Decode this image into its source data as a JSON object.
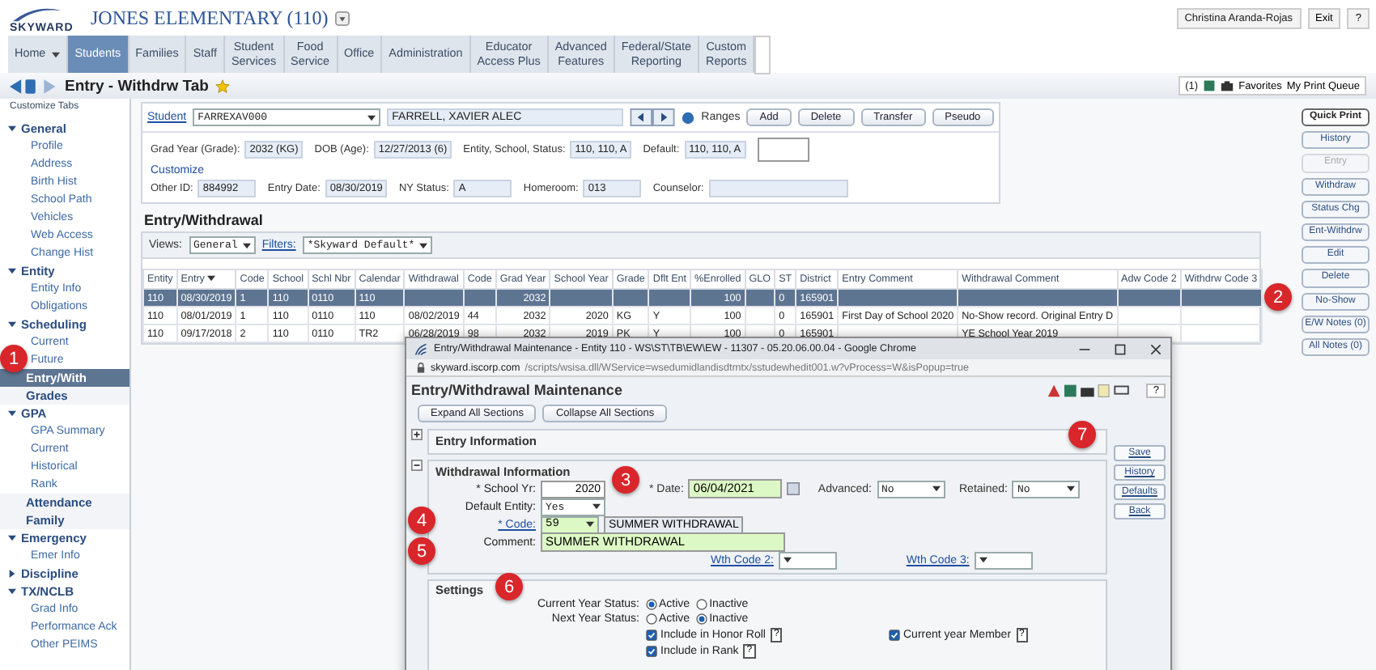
{
  "header": {
    "logo": "SKYWARD",
    "school": "JONES ELEMENTARY (110)",
    "user": "Christina Aranda-Rojas",
    "links": [
      "Exit",
      "?"
    ]
  },
  "nav": [
    {
      "label": "Home",
      "selected": false,
      "dropdown": true
    },
    {
      "label": "Students",
      "selected": true,
      "dropdown": false
    },
    {
      "label": "Families",
      "selected": false,
      "dropdown": false
    },
    {
      "label": "Staff",
      "selected": false,
      "dropdown": false
    },
    {
      "label": "Student\nServices",
      "selected": false,
      "dropdown": false
    },
    {
      "label": "Food\nService",
      "selected": false,
      "dropdown": false
    },
    {
      "label": "Office",
      "selected": false,
      "dropdown": false
    },
    {
      "label": "Administration",
      "selected": false,
      "dropdown": false
    },
    {
      "label": "Educator\nAccess Plus",
      "selected": false,
      "dropdown": false
    },
    {
      "label": "Advanced\nFeatures",
      "selected": false,
      "dropdown": false
    },
    {
      "label": "Federal/State\nReporting",
      "selected": false,
      "dropdown": false
    },
    {
      "label": "Custom\nReports",
      "selected": false,
      "dropdown": false
    }
  ],
  "crumb": {
    "title": "Entry - Withdrw Tab",
    "count": "(1)",
    "favorites": "Favorites",
    "print_queue": "My Print Queue"
  },
  "sidebar": {
    "header": "Customize Tabs",
    "items": [
      {
        "kind": "folder",
        "label": "General",
        "expanded": true,
        "children": [
          {
            "label": "Profile",
            "selected": false
          },
          {
            "label": "Address",
            "selected": false
          },
          {
            "label": "Birth Hist",
            "selected": false
          },
          {
            "label": "School Path",
            "selected": false
          },
          {
            "label": "Vehicles",
            "selected": false
          },
          {
            "label": "Web Access",
            "selected": false
          },
          {
            "label": "Change Hist",
            "selected": false
          }
        ]
      },
      {
        "kind": "folder",
        "label": "Entity",
        "expanded": true,
        "children": [
          {
            "label": "Entity Info",
            "selected": false
          },
          {
            "label": "Obligations",
            "selected": false
          }
        ]
      },
      {
        "kind": "folder",
        "label": "Scheduling",
        "expanded": true,
        "children": [
          {
            "label": "Current",
            "selected": false
          },
          {
            "label": "Future",
            "selected": false
          }
        ]
      },
      {
        "kind": "tab",
        "label": "Entry/With",
        "selected": true
      },
      {
        "kind": "tab",
        "label": "Grades",
        "selected": false
      },
      {
        "kind": "folder",
        "label": "GPA",
        "expanded": true,
        "children": [
          {
            "label": "GPA Summary",
            "selected": false
          },
          {
            "label": "Current",
            "selected": false
          },
          {
            "label": "Historical",
            "selected": false
          },
          {
            "label": "Rank",
            "selected": false
          }
        ]
      },
      {
        "kind": "tab",
        "label": "Attendance",
        "selected": false
      },
      {
        "kind": "tab",
        "label": "Family",
        "selected": false
      },
      {
        "kind": "folder",
        "label": "Emergency",
        "expanded": true,
        "children": [
          {
            "label": "Emer Info",
            "selected": false
          }
        ]
      },
      {
        "kind": "folder",
        "label": "Discipline",
        "expanded": false
      },
      {
        "kind": "folder",
        "label": "TX/NCLB",
        "expanded": true,
        "children": [
          {
            "label": "Grad Info",
            "selected": false
          },
          {
            "label": "Performance Ack",
            "selected": false
          },
          {
            "label": "Other PEIMS",
            "selected": false
          }
        ]
      }
    ]
  },
  "student": {
    "link": "Student",
    "id": "FARREXAV000",
    "name": "FARRELL, XAVIER ALEC",
    "ranges": "Ranges",
    "buttons": [
      "Add",
      "Delete",
      "Transfer",
      "Pseudo"
    ],
    "fields_top": [
      {
        "label": "Grad Year (Grade):",
        "value": "2032 (KG)"
      },
      {
        "label": "DOB (Age):",
        "value": "12/27/2013 (6)"
      },
      {
        "label": "Entity, School, Status:",
        "value": "110, 110, A"
      },
      {
        "label": "Default:",
        "value": "110, 110, A"
      }
    ],
    "customize": "Customize",
    "fields_bottom": [
      {
        "label": "Other ID:",
        "value": "884992"
      },
      {
        "label": "Entry Date:",
        "value": "08/30/2019"
      },
      {
        "label": "NY Status:",
        "value": "A"
      },
      {
        "label": "Homeroom:",
        "value": "013"
      },
      {
        "label": "Counselor:"
      }
    ]
  },
  "section": {
    "title": "Entry/Withdrawal",
    "views_label": "Views:",
    "view": "General",
    "filters_label": "Filters:",
    "filter": "*Skyward Default*"
  },
  "table": {
    "columns": [
      {
        "label": "Entity",
        "sorted": false
      },
      {
        "label": "Entry",
        "sorted": true
      },
      {
        "label": "Code",
        "sorted": false
      },
      {
        "label": "School",
        "sorted": false
      },
      {
        "label": "Schl Nbr",
        "sorted": false
      },
      {
        "label": "Calendar",
        "sorted": false
      },
      {
        "label": "Withdrawal",
        "sorted": false
      },
      {
        "label": "Code",
        "sorted": false
      },
      {
        "label": "Grad Year",
        "sorted": false
      },
      {
        "label": "School Year",
        "sorted": false
      },
      {
        "label": "Grade",
        "sorted": false
      },
      {
        "label": "Dflt Ent",
        "sorted": false
      },
      {
        "label": "%Enrolled",
        "sorted": false
      },
      {
        "label": "GLO",
        "sorted": false
      },
      {
        "label": "ST",
        "sorted": false
      },
      {
        "label": "District",
        "sorted": false
      },
      {
        "label": "Entry Comment",
        "sorted": false
      },
      {
        "label": "Withdrawal Comment",
        "sorted": false
      },
      {
        "label": "Adw Code 2",
        "sorted": false
      },
      {
        "label": "Withdrw Code 3",
        "sorted": false
      }
    ],
    "rows": [
      {
        "selected": true,
        "cells": [
          "110",
          "08/30/2019",
          "1",
          "110",
          "0110",
          "110",
          "",
          "",
          "2032",
          "",
          "",
          "",
          "100",
          "",
          "0",
          "165901",
          "",
          "",
          "",
          ""
        ]
      },
      {
        "selected": false,
        "cells": [
          "110",
          "08/01/2019",
          "1",
          "110",
          "0110",
          "110",
          "08/02/2019",
          "44",
          "2032",
          "2020",
          "KG",
          "Y",
          "100",
          "",
          "0",
          "165901",
          "First Day of School 2020",
          "No-Show record. Original Entry D",
          "",
          ""
        ]
      },
      {
        "selected": false,
        "cells": [
          "110",
          "09/17/2018",
          "2",
          "110",
          "0110",
          "TR2",
          "06/28/2019",
          "98",
          "2032",
          "2019",
          "PK",
          "Y",
          "100",
          "",
          "0",
          "165901",
          "",
          "YE School Year 2019",
          "",
          ""
        ]
      }
    ]
  },
  "actions": [
    {
      "label": "Quick Print",
      "disabled": false
    },
    {
      "label": "History",
      "disabled": false
    },
    {
      "label": "Entry",
      "disabled": true
    },
    {
      "label": "Withdraw",
      "disabled": false
    },
    {
      "label": "Status Chg",
      "disabled": false
    },
    {
      "label": "Ent-Withdrw",
      "disabled": false
    },
    {
      "label": "Edit",
      "disabled": false
    },
    {
      "label": "Delete",
      "disabled": false
    },
    {
      "label": "No-Show",
      "disabled": false
    },
    {
      "label": "E/W Notes (0)",
      "disabled": false
    },
    {
      "label": "All Notes (0)",
      "disabled": false
    }
  ],
  "popup": {
    "title": "Entry/Withdrawal Maintenance - Entity 110 - WS\\ST\\TB\\EW\\EW - 11307 - 05.20.06.00.04 - Google Chrome",
    "url_host": "skyward.iscorp.com",
    "url_path": "/scripts/wsisa.dll/WService=wsedumidlandisdtrntx/sstudewhedit001.w?vProcess=W&isPopup=true",
    "heading": "Entry/Withdrawal Maintenance",
    "help": "?",
    "section_buttons": [
      "Expand All Sections",
      "Collapse All Sections"
    ],
    "sections": [
      {
        "title": "Entry Information",
        "expanded": false
      },
      {
        "title": "Withdrawal Information",
        "expanded": true
      }
    ],
    "withdrawal": {
      "school_yr": {
        "label": "* School Yr:",
        "value": "2020",
        "highlighted": false
      },
      "date": {
        "label": "* Date:",
        "value": "06/04/2021",
        "highlighted": true
      },
      "advanced": {
        "label": "Advanced:",
        "value": "No"
      },
      "retained": {
        "label": "Retained:",
        "value": "No"
      },
      "default_entity": {
        "label": "Default Entity:",
        "value": "Yes"
      },
      "code": {
        "label": "* Code:",
        "value": "59",
        "description": "SUMMER WITHDRAWAL",
        "highlighted": true
      },
      "comment": {
        "label": "Comment:",
        "value": "SUMMER WITHDRAWAL",
        "highlighted": true
      },
      "wth_code_2": {
        "label": "Wth Code 2:"
      },
      "wth_code_3": {
        "label": "Wth Code 3:"
      }
    },
    "settings": {
      "title": "Settings",
      "statuses": [
        {
          "label": "Current Year Status:",
          "options": [
            {
              "label": "Active",
              "selected": true
            },
            {
              "label": "Inactive",
              "selected": false
            }
          ]
        },
        {
          "label": "Next Year Status:",
          "options": [
            {
              "label": "Active",
              "selected": false
            },
            {
              "label": "Inactive",
              "selected": true
            }
          ]
        }
      ],
      "checks": [
        {
          "label": "Include in Honor Roll",
          "checked": true,
          "help": "?"
        },
        {
          "label": "Current year Member",
          "checked": true,
          "help": "?"
        },
        {
          "label": "Include in Rank",
          "checked": true,
          "help": "?"
        }
      ]
    },
    "side_buttons": [
      "Save",
      "History",
      "Defaults",
      "Back"
    ]
  },
  "callouts": [
    "1",
    "2",
    "3",
    "4",
    "5",
    "6",
    "7"
  ]
}
